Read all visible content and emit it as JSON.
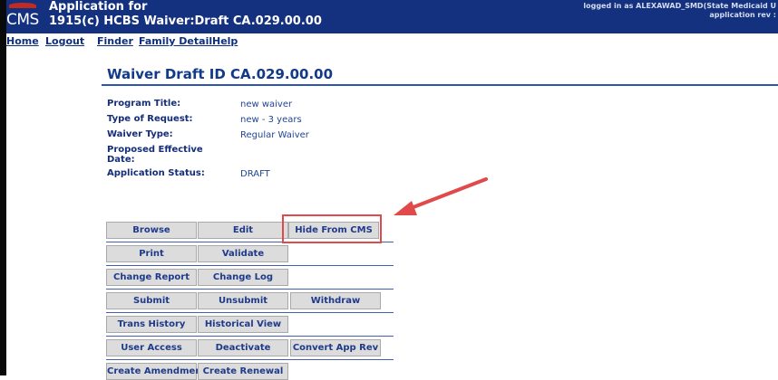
{
  "header": {
    "logo_text": "CMS",
    "title_line1": "Application for",
    "title_line2": "1915(c) HCBS Waiver:Draft CA.029.00.00",
    "logged_in": "logged in as ALEXAWAD_SMD(State Medicaid U",
    "app_rev": "application rev :"
  },
  "nav": {
    "home": "Home",
    "logout": "Logout",
    "finder": "Finder",
    "family_detail": "Family Detail",
    "help": "Help"
  },
  "page": {
    "title": "Waiver Draft ID CA.029.00.00"
  },
  "info": {
    "program_title_label": "Program Title:",
    "program_title_value": "new waiver",
    "type_of_request_label": "Type of Request:",
    "type_of_request_value": "new - 3 years",
    "waiver_type_label": "Waiver Type:",
    "waiver_type_value": "Regular Waiver",
    "proposed_effective_date_label_1": "Proposed Effective",
    "proposed_effective_date_label_2": "Date:",
    "application_status_label": "Application Status:",
    "application_status_value": "DRAFT"
  },
  "buttons": {
    "browse": "Browse",
    "edit": "Edit",
    "hide_from_cms": "Hide From CMS",
    "print": "Print",
    "validate": "Validate",
    "change_report": "Change Report",
    "change_log": "Change Log",
    "submit": "Submit",
    "unsubmit": "Unsubmit",
    "withdraw": "Withdraw",
    "trans_history": "Trans History",
    "historical_view": "Historical View",
    "user_access": "User Access",
    "deactivate": "Deactivate",
    "convert_app_rev": "Convert App Rev",
    "create_amendment": "Create Amendment",
    "create_renewal": "Create Renewal"
  },
  "colors": {
    "header_bg": "#13317e",
    "link": "#0e2f80",
    "button_bg": "#dcdcdc",
    "highlight": "#e04a4a"
  },
  "annotation": {
    "highlight_target": "hide_from_cms",
    "arrow_color": "#e04a4a"
  }
}
